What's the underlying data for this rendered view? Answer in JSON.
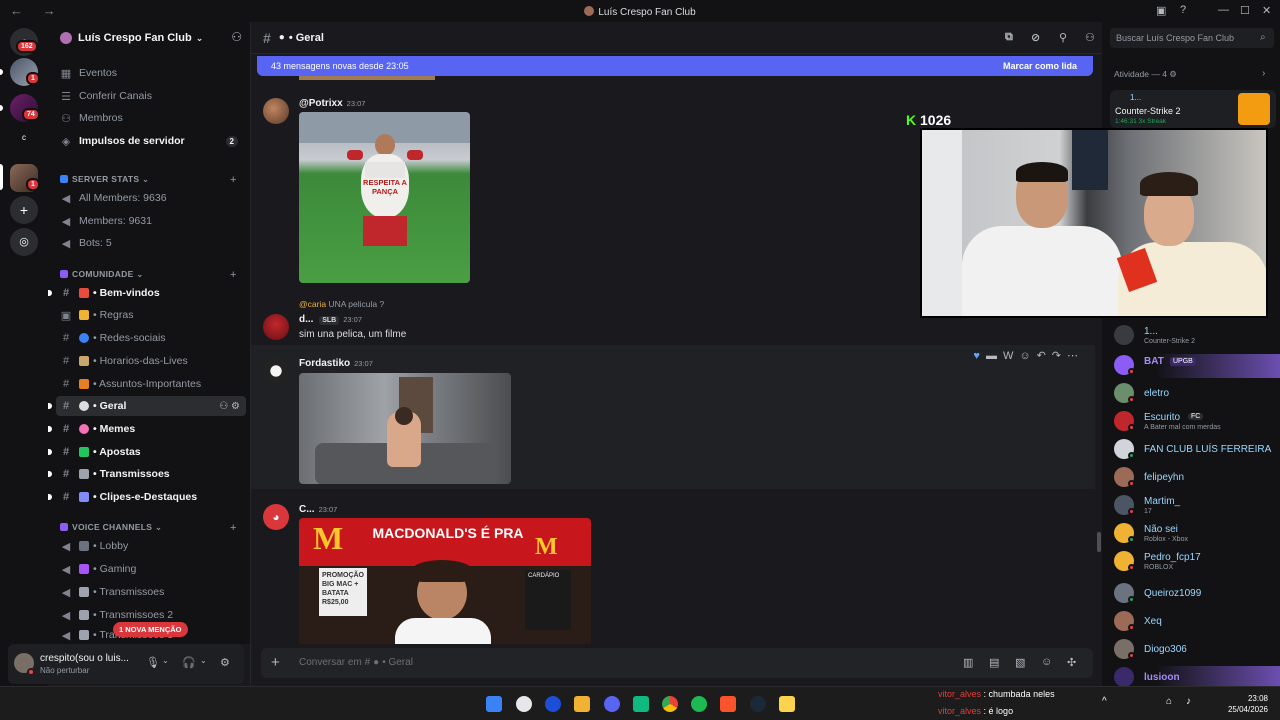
{
  "window": {
    "title": "Luís Crespo Fan Club"
  },
  "guilds": [
    {
      "name": "Discord",
      "badge": "162"
    },
    {
      "name": "Server A",
      "badge": "1"
    },
    {
      "name": "Server B",
      "badge": "74"
    },
    {
      "name": "Server C",
      "badge": ""
    },
    {
      "name": "Luís Crespo Fan Club",
      "badge": "1"
    }
  ],
  "server": {
    "name": "Luís Crespo Fan Club",
    "top_items": [
      {
        "label": "Eventos",
        "icon": "calendar-icon"
      },
      {
        "label": "Conferir Canais",
        "icon": "browse-icon"
      },
      {
        "label": "Membros",
        "icon": "members-icon"
      },
      {
        "label": "Impulsos de servidor",
        "icon": "boost-icon",
        "count": "2"
      }
    ],
    "categories": [
      {
        "label": "SERVER STATS",
        "channels": [
          "All Members: 9636",
          "Members: 9631",
          "Bots: 5"
        ]
      },
      {
        "label": "COMUNIDADE",
        "channels": [
          "• Bem-vindos",
          "• Regras",
          "• Redes-sociais",
          "• Horarios-das-Lives",
          "• Assuntos-Importantes",
          "• Geral",
          "• Memes",
          "• Apostas",
          "• Transmissoes",
          "• Clipes-e-Destaques"
        ]
      },
      {
        "label": "VOICE CHANNELS",
        "channels": [
          "• Lobby",
          "• Gaming",
          "• Transmissoes",
          "• Transmissoes 2",
          "• Transmissoes 3"
        ]
      }
    ],
    "mention_pill": "1 NOVA MENÇÃO"
  },
  "user": {
    "name": "crespito(sou o luis...",
    "status": "Não perturbar"
  },
  "channel": {
    "name": "• Geral",
    "new_messages": "43 mensagens novas desde 23:05",
    "mark_read": "Marcar como lida",
    "composer_placeholder": "Conversar em #",
    "composer_channel": "• Geral"
  },
  "messages": [
    {
      "author": "@Potrixx",
      "time": "23:07",
      "image_caption": "RESPEITA A PANÇA"
    },
    {
      "reply_to": "@caria",
      "reply_text": "UNA pelicula ?",
      "author": "d...",
      "tag": "SLB",
      "time": "23:07",
      "text": "sim una pelica, um filme"
    },
    {
      "author": "Fordastiko",
      "time": "23:07"
    },
    {
      "author": "C...",
      "time": "23:07",
      "image_caption": "MACDONALD'S É PRA",
      "promo": "PROMOÇÃO BIG MAC + BATATA R$25,00",
      "menu": "CARDÁPIO"
    }
  ],
  "members_panel": {
    "search_placeholder": "Buscar Luís Crespo Fan Club",
    "activity_label": "Atividade — 4",
    "activity_card": {
      "title": "1...",
      "game": "Counter-Strike 2",
      "stats": "1:46:31  3x Streak"
    },
    "members": [
      {
        "name": "1...",
        "sub": "Counter-Strike 2",
        "color": "#949ba4"
      },
      {
        "name": "BAT",
        "sub": "",
        "tag": "UPGB",
        "color": "#a78bfa"
      },
      {
        "name": "eletro",
        "sub": "",
        "color": "#9ad7ff"
      },
      {
        "name": "Escurito",
        "sub": "A Bater mal com merdas",
        "tag": "FC",
        "color": "#9ad7ff"
      },
      {
        "name": "FAN CLUB LUÍS FERREIRA",
        "sub": "",
        "color": "#9ad7ff"
      },
      {
        "name": "felipeyhn",
        "sub": "",
        "color": "#9ad7ff"
      },
      {
        "name": "Martim_",
        "sub": "17",
        "color": "#9ad7ff"
      },
      {
        "name": "Não sei",
        "sub": "Roblox - Xbox",
        "color": "#9ad7ff"
      },
      {
        "name": "Pedro_fcp17",
        "sub": "ROBLOX",
        "color": "#9ad7ff"
      },
      {
        "name": "Queiroz1099",
        "sub": "",
        "color": "#9ad7ff"
      },
      {
        "name": "Xeq",
        "sub": "",
        "color": "#9ad7ff"
      },
      {
        "name": "Diogo306",
        "sub": "",
        "color": "#9ad7ff"
      },
      {
        "name": "lusioon",
        "sub": "",
        "color": "#a78bfa"
      }
    ]
  },
  "stream": {
    "viewers": "1026"
  },
  "taskbar": {
    "chat_lines": [
      {
        "user": "vitor_alves",
        "text": ": chumbada neles"
      },
      {
        "user": "vitor_alves",
        "text": ": é logo"
      }
    ],
    "time": "23:08",
    "date": "25/04/2026"
  },
  "colors": {
    "accent": "#5865f2",
    "danger": "#da373c",
    "online": "#23a55a",
    "dnd": "#f23f43",
    "kick": "#53fc18"
  }
}
